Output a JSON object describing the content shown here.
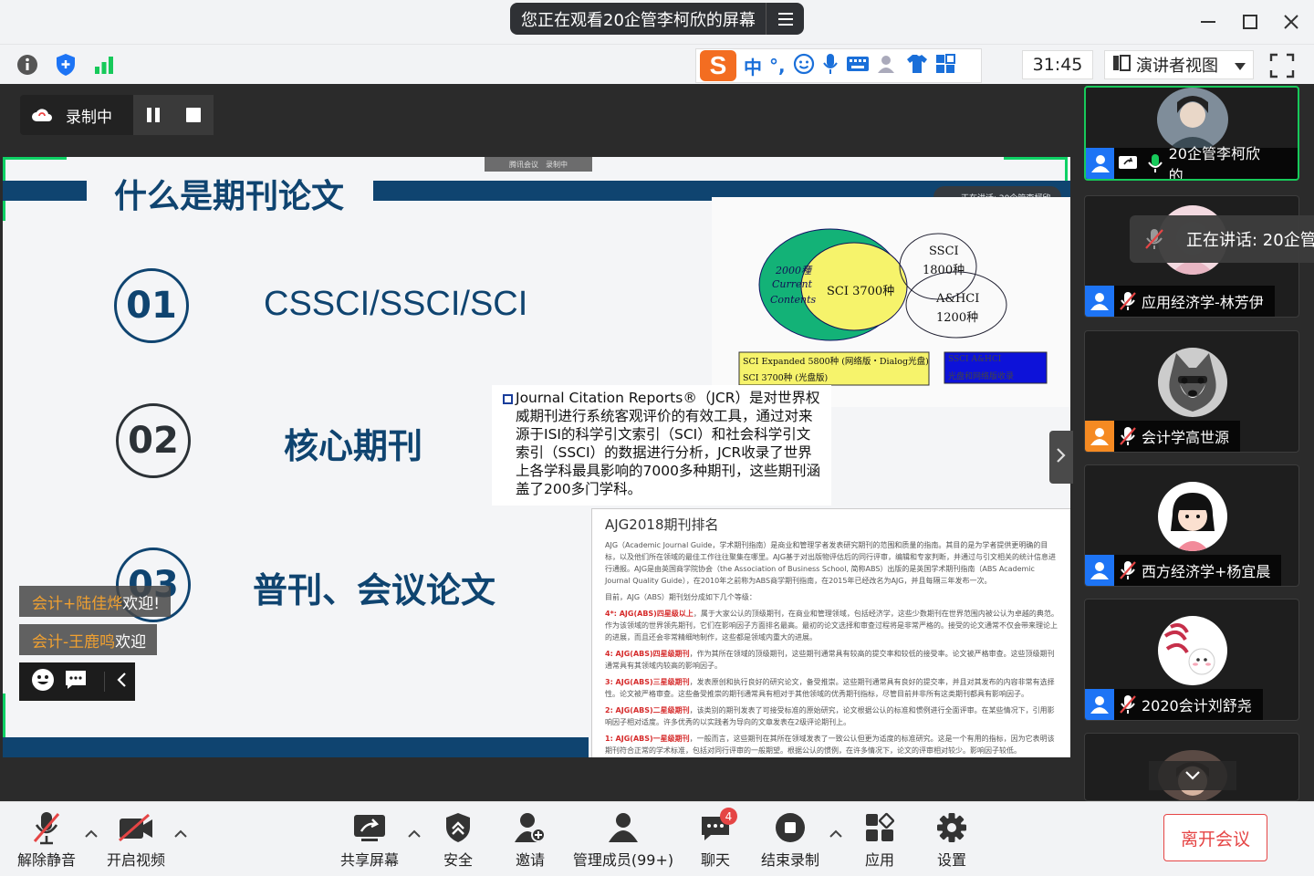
{
  "window": {
    "title": "您正在观看20企管李柯欣的屏幕"
  },
  "toolbar": {
    "timer": "31:45",
    "view_mode": "演讲者视图",
    "ime_lang": "中",
    "ime_punct": "°,"
  },
  "recording": {
    "label": "录制中"
  },
  "slide": {
    "title": "什么是期刊论文",
    "items": [
      {
        "num": "01",
        "text": "CSSCI/SSCI/SCI"
      },
      {
        "num": "02",
        "text": "核心期刊"
      },
      {
        "num": "03",
        "text": "普刊、会议论文"
      }
    ],
    "venn": {
      "sci": "SCI 3700种",
      "ssci_name": "SSCI",
      "ssci_count": "1800种",
      "ahci_name": "A&HCI",
      "ahci_count": "1200种",
      "cc_line1": "2000種",
      "cc_line2": "Current",
      "cc_line3": "Contents",
      "box1_line1": "SCI Expanded 5800种 (网络版・Dialog光盘)",
      "box1_line2": "SCI 3700种 (光盘版)",
      "box2_line1": "SSCI A&HCI",
      "box2_line2": "光盘和网络版收录"
    },
    "jcr_text": "Journal Citation Reports®（JCR）是对世界权威期刊进行系统客观评价的有效工具，通过对来源于ISI的科学引文索引（SCI）和社会科学引文索引（SSCI）的数据进行分析，JCR收录了世界上各学科最具影响的7000多种期刊，这些期刊涵盖了200多门学科。",
    "ajg": {
      "title": "AJG2018期刊排名",
      "intro": "AJG（Academic Journal Guide，学术期刊指南）是商业和管理学者发表研究期刊的范围和质量的指南。其目的是为学者提供更明确的目标，以及他们所在领域的最佳工作往往聚集在哪里。AJG基于对出版物评估后的同行评审，编辑和专家判断，并通过与引文相关的统计信息进行通报。AJG是由英国商学院协会（the Association of Business School, 简称ABS）出版的是英国学术期刊指南（ABS Academic Journal Quality Guide），在2010年之前称为ABS商学期刊指南，在2015年已经改名为AJG，并且每隔三年发布一次。",
      "levels_intro": "目前，AJG（ABS）期刊划分成如下几个等级：",
      "levels": [
        {
          "tag": "4*: AJG(ABS)四星级以上",
          "desc": "，属于大家公认的顶级期刊，在商业和管理领域，包括经济学，这些少数期刊在世界范围内被公认为卓越的典范。作为该领域的世界领先期刊，它们在影响因子方面排名最高。最初的论文选择和审查过程将是非常严格的。接受的论文通常不仅会带来理论上的进展，而且还会非常精细地制作，这些都是领域内重大的进展。"
        },
        {
          "tag": "4: AJG(ABS)四星级期刊",
          "desc": "，作为其所在领域的顶级期刊，这些期刊通常具有较高的提交率和较低的接受率。论文被严格审查。这些顶级期刊通常具有其领域内较高的影响因子。"
        },
        {
          "tag": "3: AJG(ABS)三星级期刊",
          "desc": "，发表原创和执行良好的研究论文，备受推崇。这些期刊通常具有良好的提交率，并且对其发布的内容非常有选择性。论文被严格审查。这些备受推崇的期刊通常具有相对于其他领域的优秀期刊指标，尽管目前并非所有这类期刊都具有影响因子。"
        },
        {
          "tag": "2: AJG(ABS)二星级期刊",
          "desc": "，该类别的期刊发表了可接受标准的原始研究，论文根据公认的标准和惯例进行全面评审。在某些情况下，引用影响因子相对适度。许多优秀的以实践者为导向的文章发表在2级评论期刊上。"
        },
        {
          "tag": "1: AJG(ABS)一星级期刊",
          "desc": "，一般而言，这些期刊在其所在领域发表了一致公认但更为适度的标准研究。这是一个有用的指标，因为它表明该期刊符合正常的学术标准，包括对同行评审的一般期望。根据公认的惯例，在许多情况下，论文的评审相对较少。影响因子较低。"
        }
      ]
    },
    "speaking_mini": "正在讲话: 20企管李柯欣",
    "tencent_tag": "腾讯会议",
    "tencent_rec": "录制中"
  },
  "chat": [
    {
      "name": "会计+陆佳烨",
      "msg": "欢迎!"
    },
    {
      "name": "会计-王鹿鸣",
      "msg": "欢迎"
    }
  ],
  "participants": [
    {
      "name": "20企管李柯欣的..."
    },
    {
      "name": "应用经济学-林芳伊"
    },
    {
      "name": "会计学高世源"
    },
    {
      "name": "西方经济学+杨宜晨"
    },
    {
      "name": "2020会计刘舒尧"
    }
  ],
  "speaking": "正在讲话: 20企管",
  "bottom": {
    "unmute": "解除静音",
    "video": "开启视频",
    "share": "共享屏幕",
    "security": "安全",
    "invite": "邀请",
    "members": "管理成员(99+)",
    "chat": "聊天",
    "chat_badge": "4",
    "end_rec": "结束录制",
    "apps": "应用",
    "settings": "设置",
    "leave": "离开会议"
  },
  "colors": {
    "brand_blue": "#0f4470",
    "accent_green": "#0ed165",
    "leave_red": "#e54545",
    "user_blue": "#1d74f5"
  }
}
